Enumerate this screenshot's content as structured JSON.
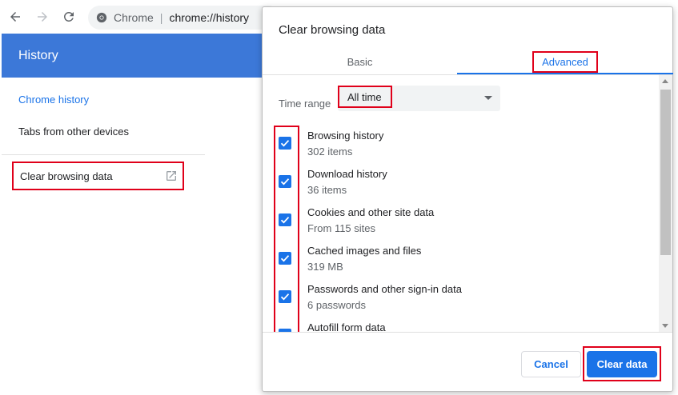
{
  "browser": {
    "omnibox_host": "Chrome",
    "omnibox_url": "chrome://history"
  },
  "history_page": {
    "header_title": "History",
    "nav": {
      "chrome_history": "Chrome history",
      "tabs_other_devices": "Tabs from other devices",
      "clear_browsing_data": "Clear browsing data"
    }
  },
  "dialog": {
    "title": "Clear browsing data",
    "tabs": [
      {
        "label": "Basic",
        "selected": false
      },
      {
        "label": "Advanced",
        "selected": true
      }
    ],
    "time_range": {
      "label": "Time range",
      "value": "All time"
    },
    "items": [
      {
        "title": "Browsing history",
        "detail": "302 items",
        "checked": true
      },
      {
        "title": "Download history",
        "detail": "36 items",
        "checked": true
      },
      {
        "title": "Cookies and other site data",
        "detail": "From 115 sites",
        "checked": true
      },
      {
        "title": "Cached images and files",
        "detail": "319 MB",
        "checked": true
      },
      {
        "title": "Passwords and other sign-in data",
        "detail": "6 passwords",
        "checked": true
      },
      {
        "title": "Autofill form data",
        "detail": "",
        "checked": true
      }
    ],
    "buttons": {
      "cancel": "Cancel",
      "clear": "Clear data"
    }
  },
  "colors": {
    "accent": "#1a73e8",
    "header": "#3c78d8",
    "highlight": "#e0001a"
  }
}
